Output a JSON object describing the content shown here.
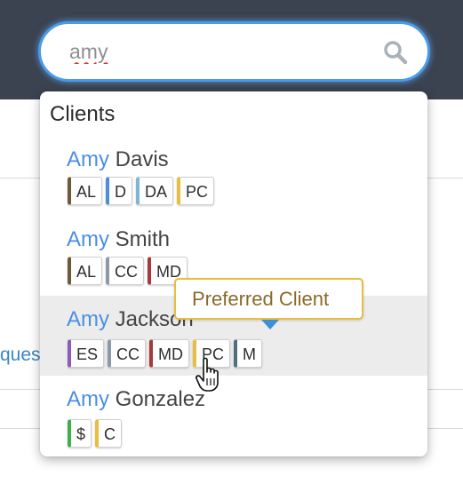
{
  "search": {
    "value": "amy"
  },
  "background": {
    "partial_link": "ques"
  },
  "dropdown": {
    "title": "Clients",
    "clients": [
      {
        "highlight": "Amy",
        "rest": " Davis",
        "badges": [
          {
            "label": "AL",
            "color": "#6e5a3a"
          },
          {
            "label": "D",
            "color": "#4a8fd8"
          },
          {
            "label": "DA",
            "color": "#7fb6d8"
          },
          {
            "label": "PC",
            "color": "#e8be3e"
          }
        ]
      },
      {
        "highlight": "Amy",
        "rest": " Smith",
        "badges": [
          {
            "label": "AL",
            "color": "#6e5a3a"
          },
          {
            "label": "CC",
            "color": "#8c9aa8"
          },
          {
            "label": "MD",
            "color": "#a63a3a"
          }
        ]
      },
      {
        "highlight": "Amy",
        "rest": " Jackson",
        "badges": [
          {
            "label": "ES",
            "color": "#8e5bb8"
          },
          {
            "label": "CC",
            "color": "#8c9aa8"
          },
          {
            "label": "MD",
            "color": "#a63a3a"
          },
          {
            "label": "PC",
            "color": "#e8be3e"
          },
          {
            "label": "M",
            "color": "#4f6f80"
          }
        ]
      },
      {
        "highlight": "Amy",
        "rest": " Gonzalez",
        "badges": [
          {
            "label": "$",
            "color": "#3eb04b"
          },
          {
            "label": "C",
            "color": "#e8be3e"
          }
        ]
      }
    ]
  },
  "tooltip": {
    "text": "Preferred Client"
  },
  "colors": {
    "topbar": "#3b4350",
    "accent": "#4a9be6",
    "highlight_text": "#4c8fe0",
    "tooltip_border": "#e8be3e"
  },
  "icons": {
    "search": "search-icon",
    "cursor": "hand-pointer-cursor"
  }
}
